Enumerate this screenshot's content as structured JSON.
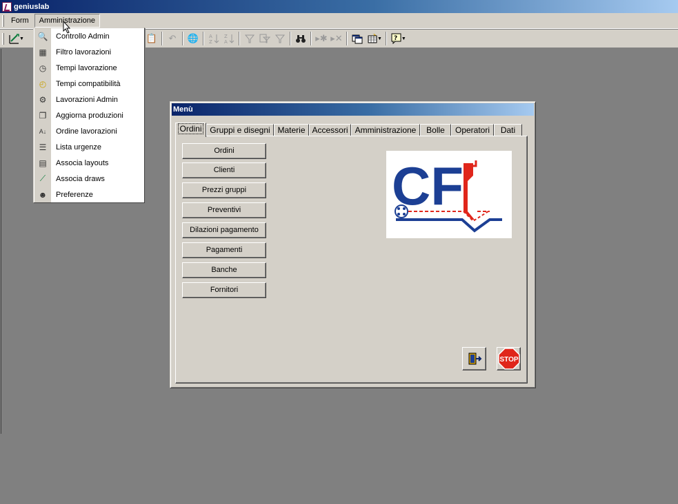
{
  "app": {
    "title": "geniuslab"
  },
  "menubar": {
    "items": [
      "Form",
      "Amministrazione"
    ]
  },
  "admin_menu": {
    "items": [
      {
        "label": "Controllo Admin",
        "icon": "magnifier-icon"
      },
      {
        "label": "Filtro lavorazioni",
        "icon": "calendar-filter-icon"
      },
      {
        "label": "Tempi lavorazione",
        "icon": "clock-icon"
      },
      {
        "label": "Tempi compatibilità",
        "icon": "clock-yellow-icon"
      },
      {
        "label": "Lavorazioni Admin",
        "icon": "gear-person-icon"
      },
      {
        "label": "Aggiorna produzioni",
        "icon": "pages-icon"
      },
      {
        "label": "Ordine lavorazioni",
        "icon": "sort-az-icon"
      },
      {
        "label": "Lista urgenze",
        "icon": "list-icon"
      },
      {
        "label": "Associa layouts",
        "icon": "layout-icon"
      },
      {
        "label": "Associa draws",
        "icon": "draw-icon"
      },
      {
        "label": "Preferenze",
        "icon": "user-preferences-icon"
      }
    ]
  },
  "menu_window": {
    "title": "Menù",
    "tabs": [
      "Ordini",
      "Gruppi e disegni",
      "Materie",
      "Accessori",
      "Amministrazione",
      "Bolle",
      "Operatori",
      "Dati"
    ],
    "active_tab": "Ordini",
    "buttons": [
      "Ordini",
      "Clienti",
      "Prezzi gruppi",
      "Preventivi",
      "Dilazioni pagamento",
      "Pagamenti",
      "Banche",
      "Fornitori"
    ],
    "logo_text": "CF",
    "stop_label": "STOP"
  },
  "colors": {
    "logo_blue": "#1c3f94",
    "logo_red": "#e0261b",
    "title_gradient_start": "#0a246a"
  }
}
